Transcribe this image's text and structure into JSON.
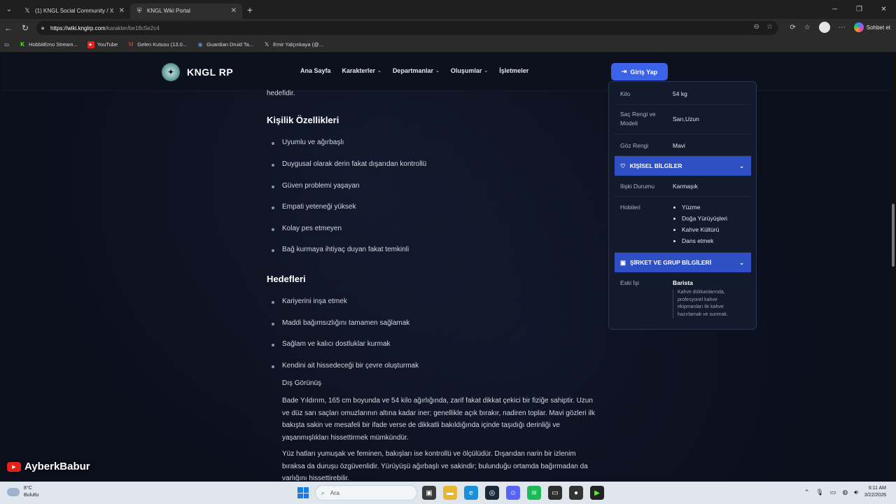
{
  "browser": {
    "tabs": [
      {
        "title": "(1) KNGL Social Community / X",
        "icon": "x-icon"
      },
      {
        "title": "KNGL Wiki Portal",
        "icon": "shield-icon"
      }
    ],
    "url_host": "https://wiki.knglrp.com",
    "url_path": "/karakter/be18c5e2c4",
    "copilot_label": "Sohbet et",
    "bookmarks": [
      {
        "label": "HobbitEmo Stream...",
        "icon": "kick-icon",
        "color": "#53fc18"
      },
      {
        "label": "YouTube",
        "icon": "youtube-icon",
        "color": "#e62117"
      },
      {
        "label": "Gelen Kutusu (13.0...",
        "icon": "gmail-icon",
        "color": "#ea4335"
      },
      {
        "label": "Guardian Druid Ta...",
        "icon": "wow-icon",
        "color": "#4f8fd6"
      },
      {
        "label": "Emir Yalçınkaya (@...",
        "icon": "x-icon",
        "color": "#000000"
      }
    ]
  },
  "site": {
    "brand": "KNGL RP",
    "nav": [
      {
        "label": "Ana Sayfa",
        "dropdown": false
      },
      {
        "label": "Karakterler",
        "dropdown": true
      },
      {
        "label": "Departmanlar",
        "dropdown": true
      },
      {
        "label": "Oluşumlar",
        "dropdown": true
      },
      {
        "label": "İşletmeler",
        "dropdown": false
      }
    ],
    "login_label": "Giriş Yap"
  },
  "content": {
    "fragment": "hedefidir.",
    "personality_heading": "Kişilik Özellikleri",
    "personality": [
      "Uyumlu ve ağırbaşlı",
      "Duygusal olarak derin fakat dışarıdan kontrollü",
      "Güven problemi yaşayan",
      "Empati yeteneği yüksek",
      "Kolay pes etmeyen",
      "Bağ kurmaya ihtiyaç duyan fakat temkinli"
    ],
    "goals_heading": "Hedefleri",
    "goals": [
      "Kariyerini inşa etmek",
      "Maddi bağımsızlığını tamamen sağlamak",
      "Sağlam ve kalıcı dostluklar kurmak",
      "Kendini ait hissedeceği bir çevre oluşturmak"
    ],
    "appearance_label": "Dış Görünüş",
    "appearance_p1": "Bade Yıldırım, 165 cm boyunda ve 54 kilo ağırlığında, zarif fakat dikkat çekici bir fiziğe sahiptir. Uzun ve düz sarı saçları omuzlarının altına kadar iner; genellikle açık bırakır, nadiren toplar. Mavi gözleri ilk bakışta sakin ve mesafeli bir ifade verse de dikkatli bakıldığında içinde taşıdığı derinliği ve yaşanmışlıkları hissettirmek mümkündür.",
    "appearance_p2": "Yüz hatları yumuşak ve feminen, bakışları ise kontrollü ve ölçülüdür. Dışarıdan narin bir izlenim bıraksa da duruşu özgüvenlidir. Yürüyüşü ağırbaşlı ve sakindir; bulunduğu ortamda bağırmadan da varlığını hissettirebilir."
  },
  "sidebar": {
    "physical": [
      {
        "key": "Kilo",
        "value": "54 kg"
      },
      {
        "key": "Saç Rengi ve Modeli",
        "value": "Sarı,Uzun"
      },
      {
        "key": "Göz Rengi",
        "value": "Mavi"
      }
    ],
    "personal_heading": "KİŞİSEL BİLGİLER",
    "relationship_key": "İlişki Durumu",
    "relationship_value": "Karmaşık",
    "hobbies_key": "Hobileri",
    "hobbies": [
      "Yüzme",
      "Doğa Yürüyüşleri",
      "Kahve Kültürü",
      "Dans etmek"
    ],
    "company_heading": "ŞİRKET VE GRUP BİLGİLERİ",
    "job_key": "Eski İşi",
    "job_title": "Barista",
    "job_desc": "Kahve dükkanlarında, profesyonel kahve ekipmanları ile kahve hazırlamak ve sunmak."
  },
  "watermark": "AyberkBabur",
  "taskbar": {
    "temperature": "8°C",
    "weather_text": "Bulutlu",
    "search_placeholder": "Ara",
    "time": "6:11 AM",
    "date": "3/22/2026"
  }
}
